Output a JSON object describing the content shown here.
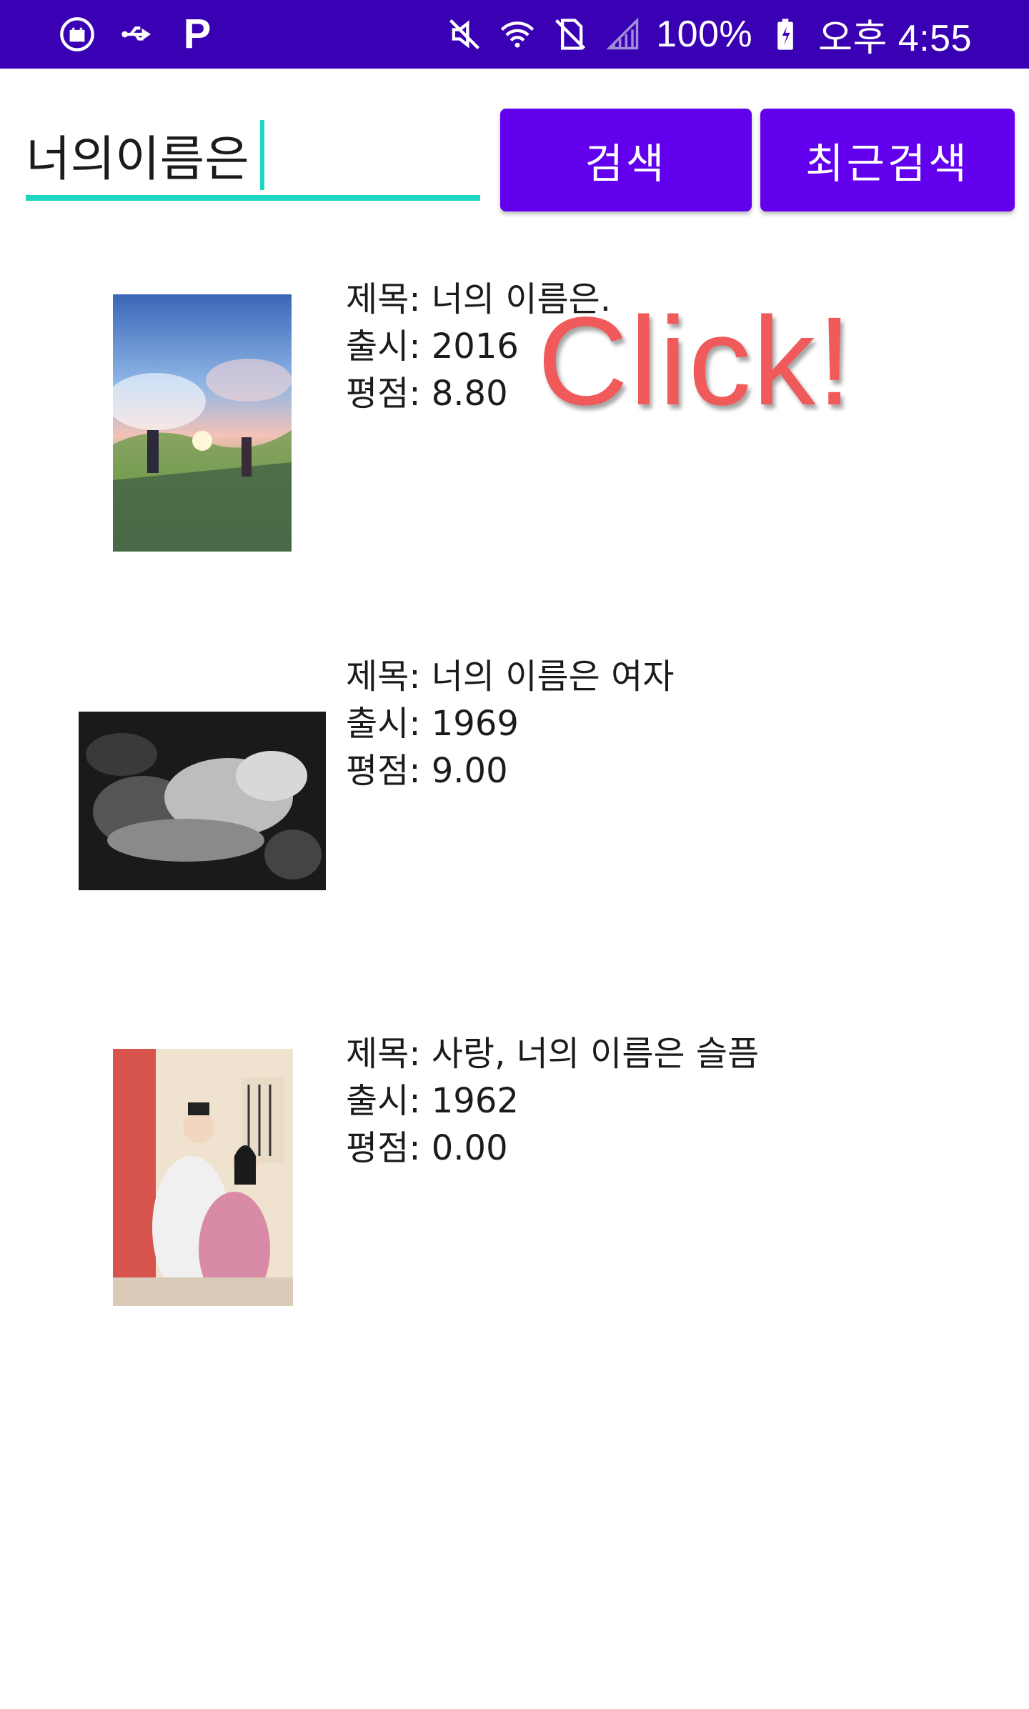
{
  "status_bar": {
    "battery": "100%",
    "time": "오후 4:55",
    "background": "#3a00b3",
    "left_icons": [
      "android-debug-icon",
      "usb-icon",
      "p-app-icon"
    ],
    "right_icons": [
      "mute-icon",
      "wifi-icon",
      "no-sim-icon",
      "signal-icon",
      "battery-charging-icon"
    ]
  },
  "search": {
    "value": "너의이름은",
    "underline_color": "#1fd6c1"
  },
  "buttons": {
    "search_label": "검색",
    "recent_label": "최근검색",
    "color": "#6200ee"
  },
  "results": [
    {
      "title": "제목: 너의 이름은.",
      "release": "출시: 2016",
      "rating": "평점: 8.80"
    },
    {
      "title": "제목: 너의 이름은 여자",
      "release": "출시: 1969",
      "rating": "평점: 9.00"
    },
    {
      "title": "제목: 사랑, 너의 이름은 슬픔",
      "release": "출시: 1962",
      "rating": "평점: 0.00"
    }
  ],
  "overlay": {
    "text": "Click!",
    "color": "#f05a5a"
  }
}
